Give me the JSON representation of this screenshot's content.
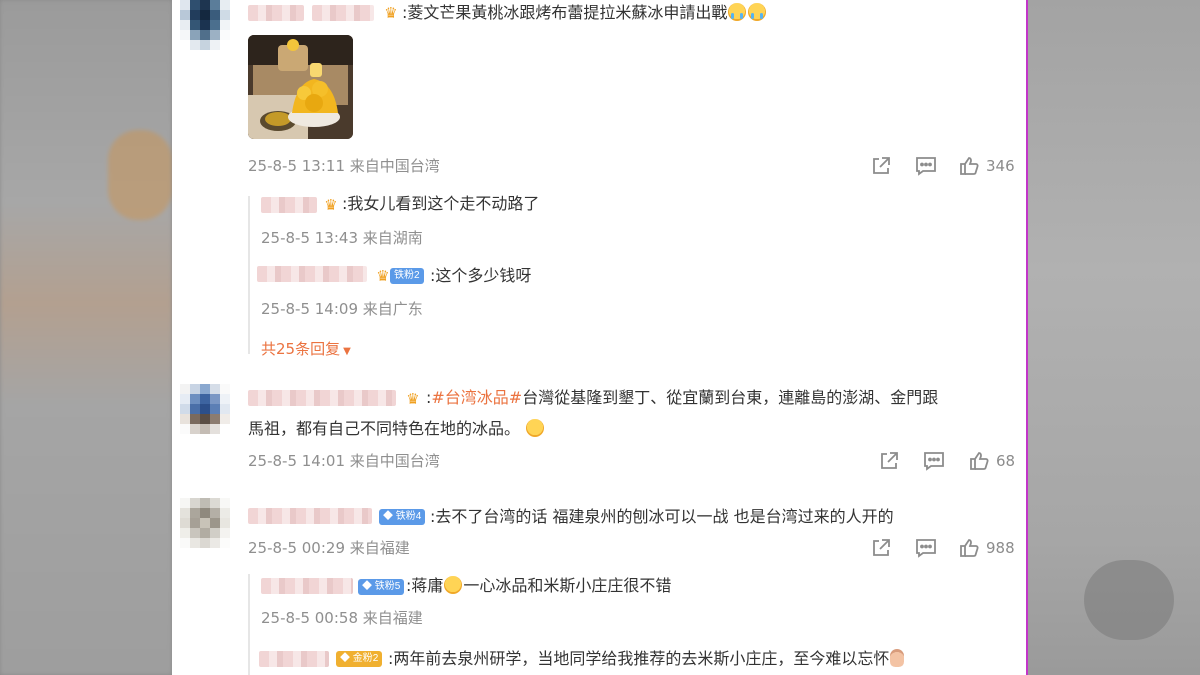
{
  "comments": [
    {
      "text": ":菱文芒果黃桃冰跟烤布蕾提拉米蘇冰申請出戰",
      "meta": "25-8-5 13:11 来自中国台湾",
      "likes": "346"
    },
    {
      "text_hashtag": "#台湾冰品#",
      "text_line1": "台灣從基隆到墾丁、從宜蘭到台東，連離島的澎湖、金門跟",
      "text_line2": "馬祖，都有自己不同特色在地的冰品。",
      "meta": "25-8-5 14:01 来自中国台湾",
      "likes": "68"
    },
    {
      "badge": "铁粉4",
      "text": ":去不了台湾的话 福建泉州的刨冰可以一战 也是台湾过来的人开的",
      "meta": "25-8-5 00:29 来自福建",
      "likes": "988"
    }
  ],
  "replies": [
    {
      "text": ":我女儿看到这个走不动路了",
      "meta": "25-8-5 13:43 来自湖南"
    },
    {
      "badge": "铁粉2",
      "text": ":这个多少钱呀",
      "meta": "25-8-5 14:09 来自广东"
    },
    {
      "badge": "铁粉5",
      "text_before": ":蒋庸",
      "text_after": "一心冰品和米斯小庄庄很不错",
      "meta": "25-8-5 00:58 来自福建"
    },
    {
      "badge": "金粉2",
      "text": ":两年前去泉州研学，当地同学给我推荐的去米斯小庄庄，至今难以忘怀"
    }
  ],
  "more_replies": "共25条回复",
  "colors": {
    "accent_orange": "#eb7340",
    "meta_gray": "#8f8f8f",
    "badge_blue": "#5b9ae8",
    "badge_gold": "#f0b030"
  },
  "icons": [
    "crown-icon",
    "share-icon",
    "comment-icon",
    "like-icon",
    "chevron-down-icon"
  ]
}
